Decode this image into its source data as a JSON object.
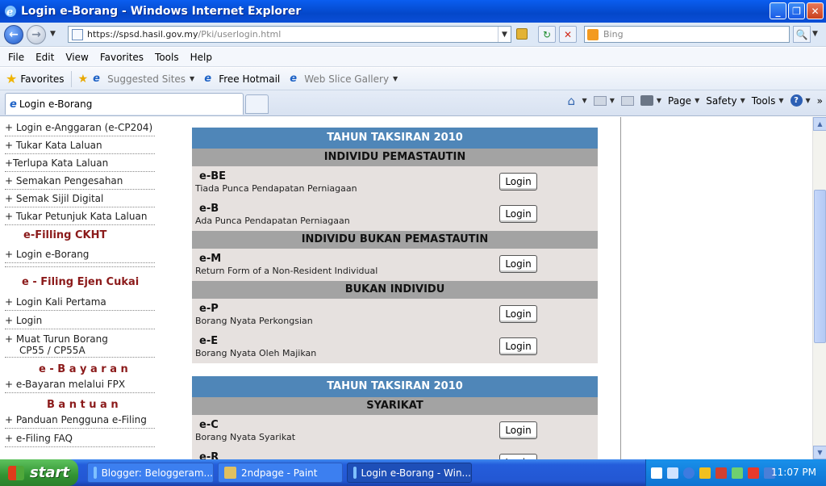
{
  "window": {
    "title": "Login e-Borang - Windows Internet Explorer",
    "min": "_",
    "max": "❐",
    "close": "✕"
  },
  "address": {
    "url_host": "https://spsd.hasil.gov.my",
    "url_path": "/Pki/userlogin.html",
    "search_placeholder": "Bing"
  },
  "menu": [
    "File",
    "Edit",
    "View",
    "Favorites",
    "Tools",
    "Help"
  ],
  "favorites": {
    "label": "Favorites",
    "items": [
      "Suggested Sites",
      "Free Hotmail",
      "Web Slice Gallery"
    ]
  },
  "tab": {
    "title": "Login e-Borang"
  },
  "commands": [
    "Page",
    "Safety",
    "Tools"
  ],
  "sidebar": {
    "links1": [
      "+ Login e-Anggaran (e-CP204)",
      "+ Tukar Kata Laluan",
      "+Terlupa Kata Laluan",
      "+ Semakan Pengesahan",
      "+ Semak Sijil Digital",
      "+ Tukar Petunjuk Kata Laluan"
    ],
    "head_ckht": "e-Filling CKHT",
    "link_ckht": "+ Login e-Borang",
    "head_ejen": "e - Filing Ejen Cukai",
    "links_ejen": [
      "+ Login Kali Pertama",
      "+ Login"
    ],
    "muat_turun_1": "+ Muat Turun Borang",
    "muat_turun_2": "CP55 / CP55A",
    "head_bayaran": "e - B a y a r a n",
    "link_bayaran": "+ e-Bayaran melalui FPX",
    "head_bantuan": "B a n t u a n",
    "links_bantuan": [
      "+ Panduan Pengguna e-Filing",
      "+ e-Filing FAQ"
    ]
  },
  "panel1": {
    "title": "TAHUN TAKSIRAN 2010",
    "sec1": "INDIVIDU PEMASTAUTIN",
    "sec2": "INDIVIDU BUKAN PEMASTAUTIN",
    "sec3": "BUKAN INDIVIDU",
    "rows": [
      {
        "code": "e-BE",
        "desc": "Tiada Punca Pendapatan Perniagaan"
      },
      {
        "code": "e-B",
        "desc": "Ada Punca Pendapatan Perniagaan"
      },
      {
        "code": "e-M",
        "desc": "Return Form of a Non-Resident Individual"
      },
      {
        "code": "e-P",
        "desc": "Borang Nyata Perkongsian"
      },
      {
        "code": "e-E",
        "desc": "Borang Nyata Oleh Majikan"
      }
    ]
  },
  "panel2": {
    "title": "TAHUN TAKSIRAN 2010",
    "sec1": "SYARIKAT",
    "rows": [
      {
        "code": "e-C",
        "desc": "Borang Nyata Syarikat"
      },
      {
        "code": "e-R",
        "desc": ""
      }
    ]
  },
  "login_label": "Login",
  "taskbar": {
    "start": "start",
    "tasks": [
      "Blogger: Beloggeram...",
      "2ndpage - Paint",
      "Login e-Borang - Win..."
    ],
    "clock": "11:07 PM"
  }
}
